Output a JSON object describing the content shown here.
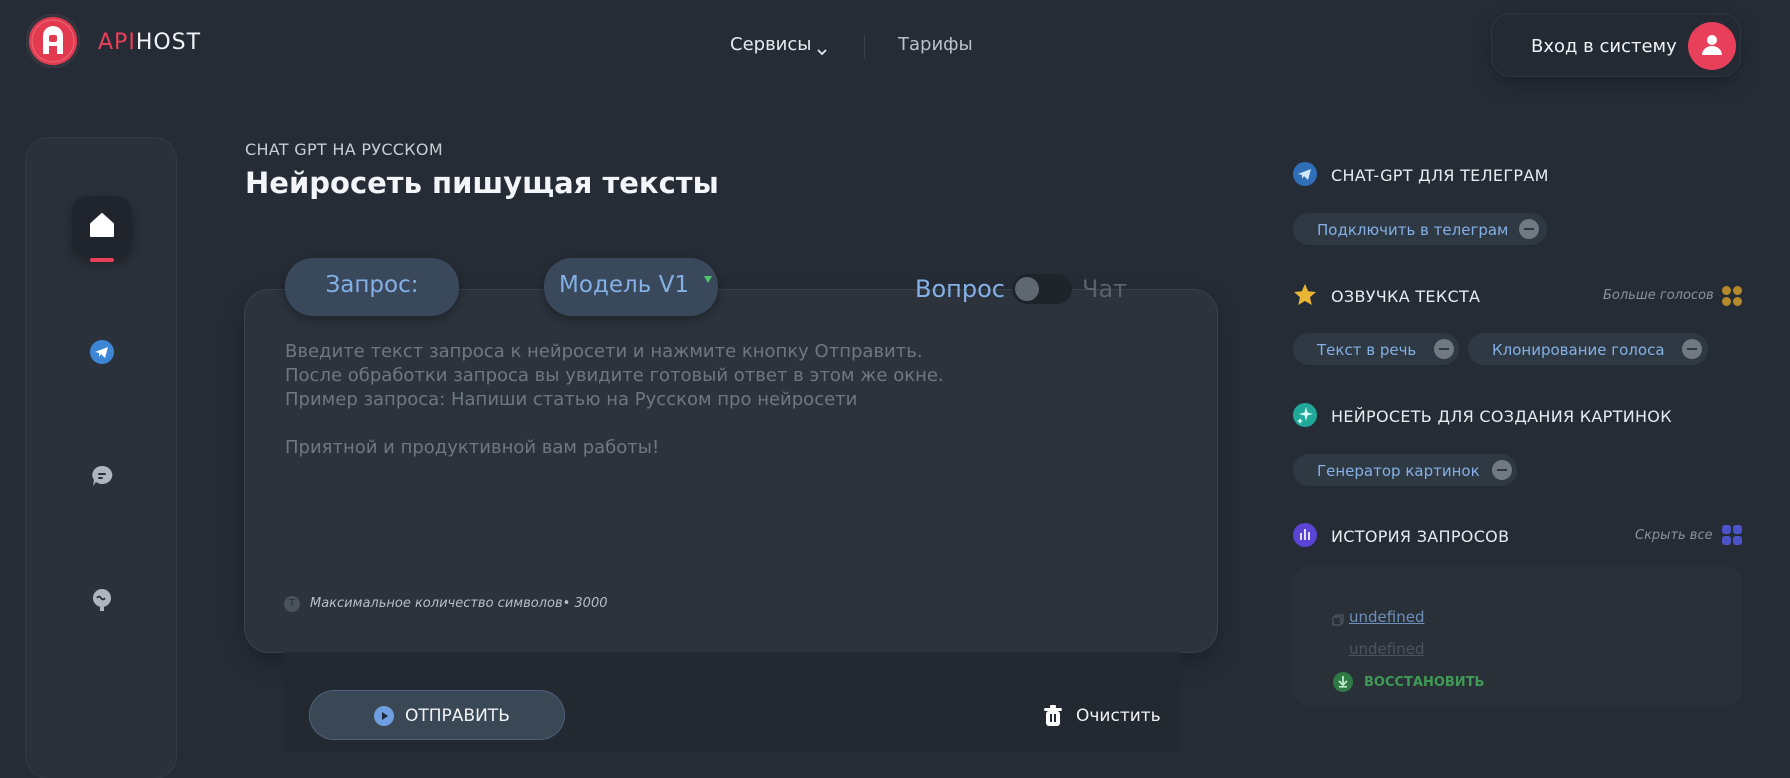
{
  "header": {
    "logo_part1": "API",
    "logo_part2": "HOST",
    "nav_services": "Сервисы",
    "nav_tariffs": "Тарифы",
    "login": "Вход в систему"
  },
  "main": {
    "eyebrow": "CHAT GPT НА РУССКОМ",
    "title": "Нейросеть пишущая тексты",
    "request_label": "Запрос:",
    "model_label": "Модель V1",
    "mode_question": "Вопрос",
    "mode_chat": "Чат",
    "mode_chat_enabled": false,
    "prompt_placeholder": "Введите текст запроса к нейросети и нажмите кнопку Отправить.\nПосле обработки запроса вы увидите готовый ответ в этом же окне.\nПример запроса: Напиши статью на Русском про нейросети\n\nПриятной и продуктивной вам работы!",
    "char_limit_label": "Максимальное количество символов• 3000",
    "send_label": "ОТПРАВИТЬ",
    "clear_label": "Очистить"
  },
  "right_panel": {
    "telegram": {
      "title": "CHAT-GPT ДЛЯ ТЕЛЕГРАМ",
      "chips": [
        "Подключить в телеграм"
      ]
    },
    "voice": {
      "title": "ОЗВУЧКА ТЕКСТА",
      "extra": "Больше голосов",
      "chips": [
        "Текст в речь",
        "Клонирование голоса"
      ]
    },
    "images": {
      "title": "НЕЙРОСЕТЬ ДЛЯ СОЗДАНИЯ КАРТИНОК",
      "chips": [
        "Генератор картинок"
      ]
    },
    "history": {
      "title": "ИСТОРИЯ ЗАПРОСОВ",
      "extra": "Скрыть все",
      "items": [
        "undefined",
        "undefined"
      ],
      "restore_label": "ВОССТАНОВИТЬ"
    }
  },
  "colors": {
    "background": "#262c35",
    "accent_red": "#e8405a",
    "accent_blue": "#84b0e6",
    "success_green": "#3f9a55"
  },
  "icons": {
    "logo": "apihost-logo-icon",
    "services_chevron": "chevron-down-icon",
    "avatar": "user-icon",
    "sidebar": [
      "home-icon",
      "telegram-icon",
      "chat-bubble-icon",
      "monitor-chat-icon"
    ],
    "send": "play-icon",
    "clear": "trash-icon",
    "telegram": "telegram-icon",
    "voice": "star-icon",
    "images": "sparkle-icon",
    "history": "equalizer-icon",
    "grid": "grid-icon",
    "restore": "download-icon"
  }
}
